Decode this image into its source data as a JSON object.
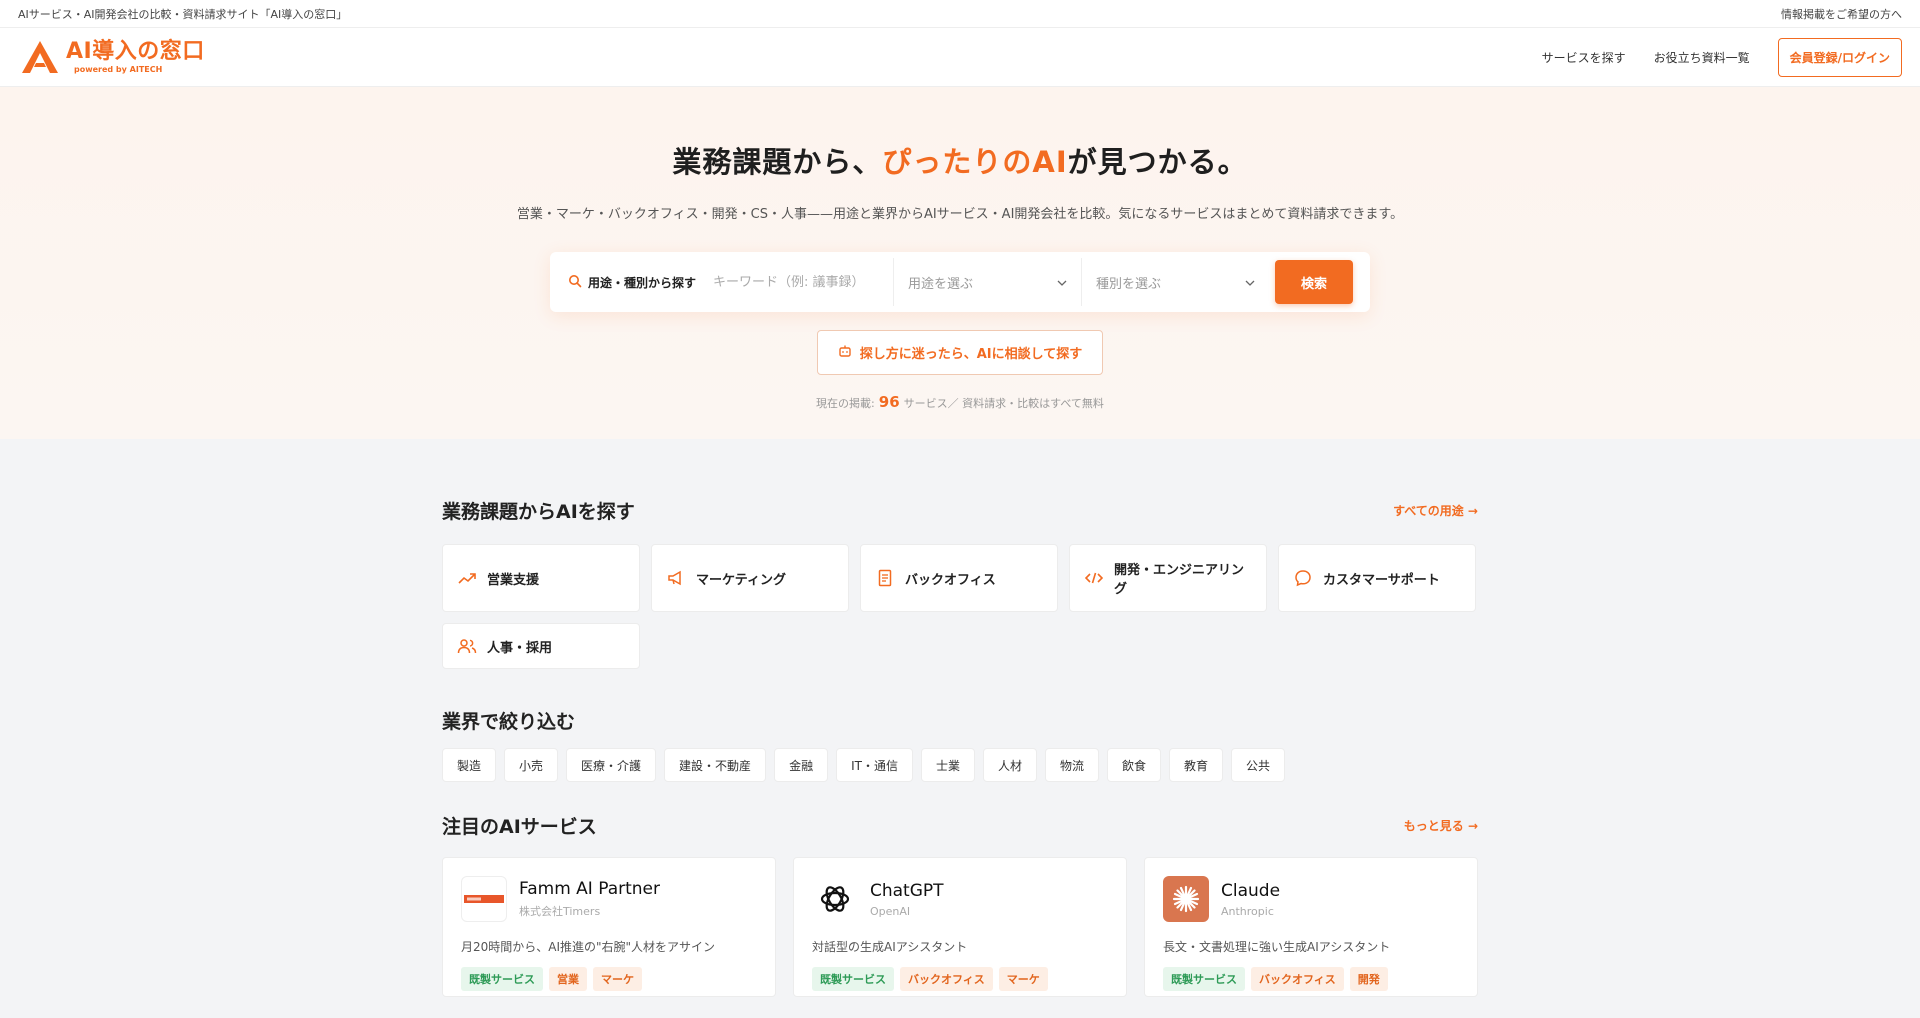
{
  "topbar": {
    "left": "AIサービス・AI開発会社の比較・資料請求サイト「AI導入の窓口」",
    "right": "情報掲載をご希望の方へ"
  },
  "header": {
    "logo_text": "AI導入の窓口",
    "logo_sub": "powered by AITECH",
    "nav": [
      "サービスを探す",
      "お役立ち資料一覧"
    ],
    "login": "会員登録/ログイン"
  },
  "hero": {
    "title_pre": "業務課題から、",
    "title_accent": "ぴったりのAI",
    "title_post": "が見つかる。",
    "subtitle": "営業・マーケ・バックオフィス・開発・CS・人事——用途と業界からAIサービス・AI開発会社を比較。気になるサービスはまとめて資料請求できます。",
    "search_label": "用途・種別から探す",
    "keyword_placeholder": "キーワード（例: 議事録）",
    "purpose_select": "用途を選ぶ",
    "type_select": "種別を選ぶ",
    "search_button": "検索",
    "ai_consult": "探し方に迷ったら、AIに相談して探す",
    "stats_pre": "現在の掲載:",
    "stats_num": "96",
    "stats_post": "サービス／ 資料請求・比較はすべて無料"
  },
  "purpose": {
    "title": "業務課題からAIを探す",
    "link": "すべての用途 →",
    "items": [
      {
        "label": "営業支援",
        "icon": "trend-up-icon"
      },
      {
        "label": "マーケティング",
        "icon": "megaphone-icon"
      },
      {
        "label": "バックオフィス",
        "icon": "document-icon"
      },
      {
        "label": "開発・エンジニアリング",
        "icon": "code-icon"
      },
      {
        "label": "カスタマーサポート",
        "icon": "chat-icon"
      },
      {
        "label": "人事・採用",
        "icon": "users-icon"
      }
    ]
  },
  "industry": {
    "title": "業界で絞り込む",
    "items": [
      "製造",
      "小売",
      "医療・介護",
      "建設・不動産",
      "金融",
      "IT・通信",
      "士業",
      "人材",
      "物流",
      "飲食",
      "教育",
      "公共"
    ]
  },
  "featured": {
    "title": "注目のAIサービス",
    "link": "もっと見る →",
    "cards": [
      {
        "name": "Famm AI Partner",
        "company": "株式会社Timers",
        "desc": "月20時間から、AI推進の\"右腕\"人材をアサイン",
        "tags": [
          {
            "t": "既製サービス",
            "c": "green"
          },
          {
            "t": "営業",
            "c": "orange"
          },
          {
            "t": "マーケ",
            "c": "orange"
          }
        ]
      },
      {
        "name": "ChatGPT",
        "company": "OpenAI",
        "desc": "対話型の生成AIアシスタント",
        "tags": [
          {
            "t": "既製サービス",
            "c": "green"
          },
          {
            "t": "バックオフィス",
            "c": "orange"
          },
          {
            "t": "マーケ",
            "c": "orange"
          }
        ]
      },
      {
        "name": "Claude",
        "company": "Anthropic",
        "desc": "長文・文書処理に強い生成AIアシスタント",
        "tags": [
          {
            "t": "既製サービス",
            "c": "green"
          },
          {
            "t": "バックオフィス",
            "c": "orange"
          },
          {
            "t": "開発",
            "c": "orange"
          }
        ]
      }
    ]
  },
  "colors": {
    "accent": "#f26b21",
    "tag_green": "#2e9b57"
  }
}
